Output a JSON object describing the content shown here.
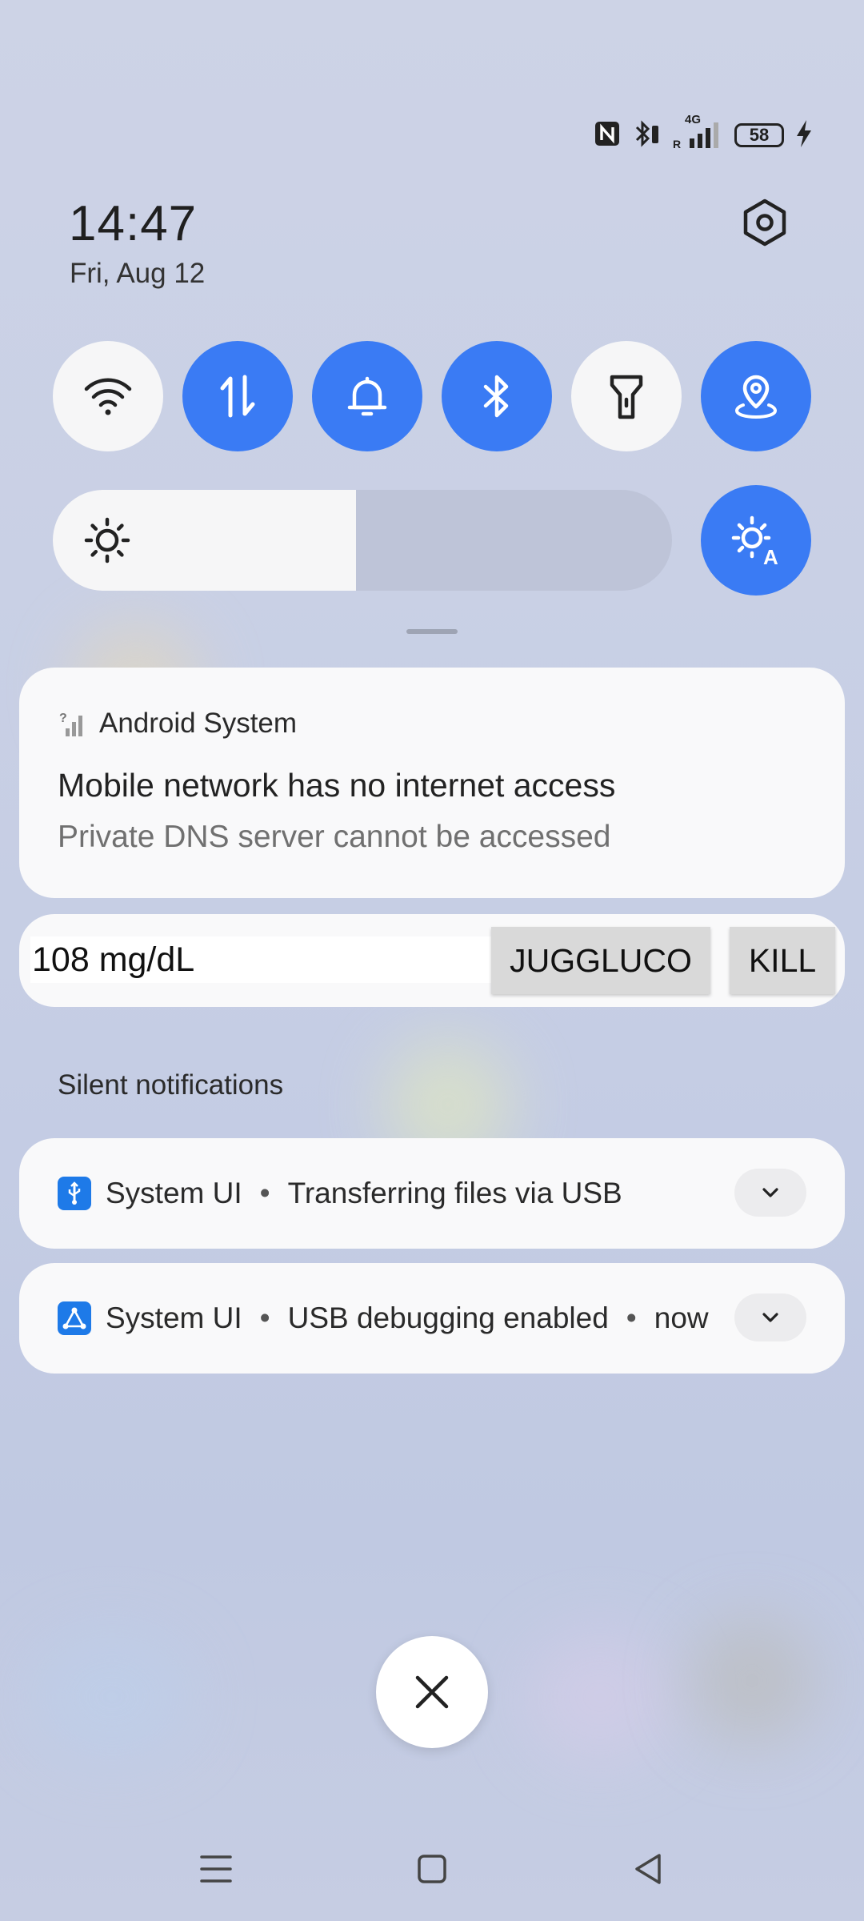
{
  "status_bar": {
    "battery_level": "58",
    "network_label": "4G",
    "icons": [
      "nfc-icon",
      "bluetooth-battery-icon",
      "signal-icon",
      "battery-icon",
      "charging-icon"
    ]
  },
  "header": {
    "time": "14:47",
    "date": "Fri, Aug 12"
  },
  "quick_settings": {
    "toggles": [
      {
        "name": "wifi",
        "icon": "wifi-icon",
        "state": "off"
      },
      {
        "name": "mobile-data",
        "icon": "data-arrows-icon",
        "state": "on"
      },
      {
        "name": "sound",
        "icon": "bell-icon",
        "state": "on"
      },
      {
        "name": "bluetooth",
        "icon": "bluetooth-icon",
        "state": "on"
      },
      {
        "name": "flashlight",
        "icon": "flashlight-icon",
        "state": "off"
      },
      {
        "name": "location",
        "icon": "location-icon",
        "state": "on"
      }
    ],
    "brightness_level": 0.49,
    "accent_color": "#3a7bf4"
  },
  "notifications": {
    "android_system": {
      "app_name": "Android System",
      "title": "Mobile network has no internet access",
      "text": "Private DNS server cannot be accessed"
    },
    "glucose": {
      "value": "108 mg/dL",
      "button_juggluco": "JUGGLUCO",
      "button_kill": "KILL"
    },
    "silent_header": "Silent notifications",
    "silent": [
      {
        "app": "System UI",
        "text": "Transferring files via USB",
        "time": ""
      },
      {
        "app": "System UI",
        "text": "USB debugging enabled",
        "time": "now"
      }
    ]
  },
  "separator": "•"
}
